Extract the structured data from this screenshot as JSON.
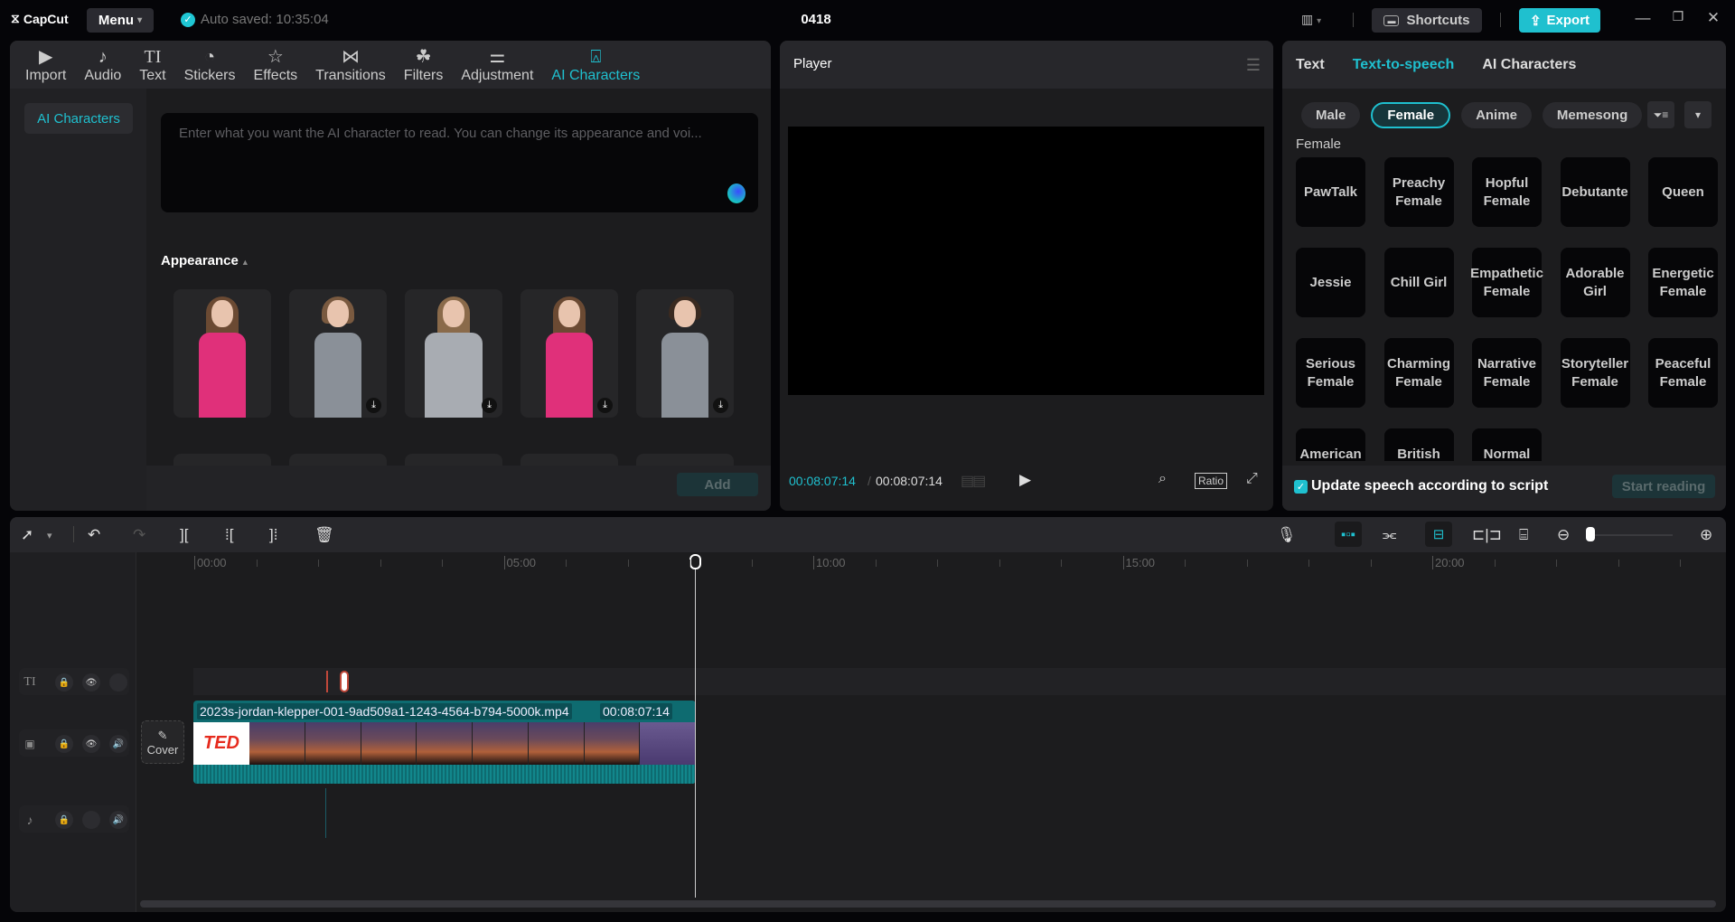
{
  "app": {
    "logo": "CapCut",
    "menu_label": "Menu",
    "autosave": "Auto saved: 10:35:04",
    "project_title": "0418",
    "shortcuts_label": "Shortcuts",
    "export_label": "Export",
    "accent": "#1fc0cf"
  },
  "toolbar": {
    "items": [
      {
        "label": "Import",
        "icon": "import-icon"
      },
      {
        "label": "Audio",
        "icon": "audio-icon"
      },
      {
        "label": "Text",
        "icon": "text-icon"
      },
      {
        "label": "Stickers",
        "icon": "sticker-icon"
      },
      {
        "label": "Effects",
        "icon": "effects-icon"
      },
      {
        "label": "Transitions",
        "icon": "transitions-icon"
      },
      {
        "label": "Filters",
        "icon": "filters-icon"
      },
      {
        "label": "Adjustment",
        "icon": "adjustment-icon"
      },
      {
        "label": "AI Characters",
        "icon": "ai-characters-icon",
        "active": true
      }
    ]
  },
  "left_panel": {
    "sidebar_item": "AI Characters",
    "script_placeholder": "Enter what you want the AI character to read. You can change its appearance and voi...",
    "appearance_label": "Appearance",
    "add_label": "Add",
    "avatars": [
      {
        "outfit": "pink top",
        "downloadable": false
      },
      {
        "outfit": "grey sports top",
        "downloadable": true
      },
      {
        "outfit": "grey sweater, glasses",
        "downloadable": true
      },
      {
        "outfit": "pink top",
        "downloadable": true
      },
      {
        "outfit": "grey sports top",
        "downloadable": true
      }
    ]
  },
  "player": {
    "title": "Player",
    "current_time": "00:08:07:14",
    "total_time": "00:08:07:14",
    "ratio_label": "Ratio"
  },
  "right_panel": {
    "tabs": [
      "Text",
      "Text-to-speech",
      "AI Characters"
    ],
    "active_tab": "Text-to-speech",
    "chips": [
      "Male",
      "Female",
      "Anime",
      "Memesong"
    ],
    "active_chip": "Female",
    "category_label": "Female",
    "voices": [
      "PawTalk",
      "Preachy Female",
      "Hopful Female",
      "Debutante",
      "Queen",
      "Jessie",
      "Chill Girl",
      "Empathetic Female",
      "Adorable Girl",
      "Energetic Female",
      "Serious Female",
      "Charming Female",
      "Narrative Female",
      "Storyteller Female",
      "Peaceful Female",
      "American Female",
      "British Female",
      "Normal Female"
    ],
    "update_speech_label": "Update speech according to script",
    "update_speech_checked": true,
    "start_reading_label": "Start reading"
  },
  "timeline": {
    "ruler": [
      "00:00",
      "05:00",
      "10:00",
      "15:00",
      "20:00"
    ],
    "cover_label": "Cover",
    "clip": {
      "name": "2023s-jordan-klepper-001-9ad509a1-1243-4564-b794-5000k.mp4",
      "duration": "00:08:07:14",
      "thumb_label": "TED"
    },
    "zoom_level": 0.05
  }
}
